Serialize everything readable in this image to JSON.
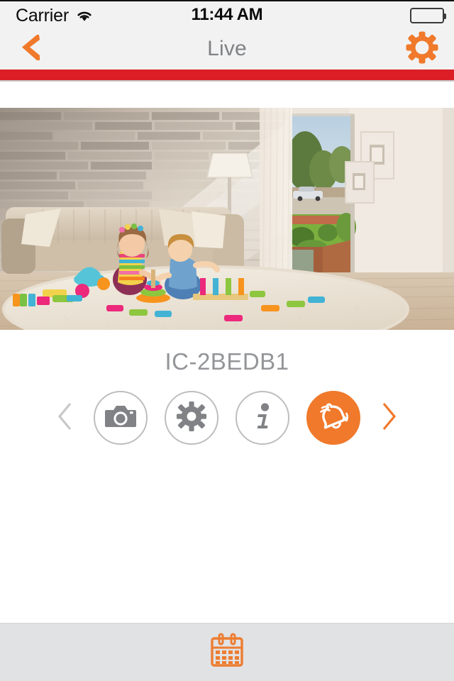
{
  "status_bar": {
    "carrier": "Carrier",
    "wifi_icon": "wifi-icon",
    "time": "11:44 AM",
    "battery_icon": "battery-full-icon"
  },
  "nav_bar": {
    "title": "Live",
    "back_icon": "chevron-left-icon",
    "settings_icon": "gear-icon",
    "accent_color": "#f0792b",
    "title_color": "#808285",
    "bar_color": "#f2f2f2",
    "divider_color": "#dc1f26"
  },
  "live_view": {
    "label": "live-camera-feed",
    "description": "Living room with two children playing with colorful wooden toys on a cream shag rug in front of a beige sofa, stone wall behind, glass door to garden at right"
  },
  "device": {
    "name": "IC-2BEDB1",
    "name_color": "#939598"
  },
  "controls": {
    "prev_arrow": {
      "icon": "chevron-left-icon",
      "name": "previous-camera-arrow",
      "color": "#c7c8ca",
      "enabled": false
    },
    "next_arrow": {
      "icon": "chevron-right-icon",
      "name": "next-camera-arrow",
      "color": "#f0792b",
      "enabled": true
    },
    "buttons": [
      {
        "name": "snapshot-button",
        "icon": "camera-icon",
        "style": "outline",
        "color": "#808285"
      },
      {
        "name": "camera-settings-button",
        "icon": "gear-icon",
        "style": "outline",
        "color": "#808285"
      },
      {
        "name": "camera-info-button",
        "icon": "info-icon",
        "style": "outline",
        "color": "#808285"
      },
      {
        "name": "alert-sound-button",
        "icon": "bell-icon",
        "style": "filled",
        "color": "#ffffff",
        "background": "#f0792b"
      }
    ]
  },
  "bottom_bar": {
    "background": "#e1e2e4",
    "items": [
      {
        "name": "calendar-button",
        "icon": "calendar-icon",
        "color": "#ed7d31"
      }
    ]
  }
}
